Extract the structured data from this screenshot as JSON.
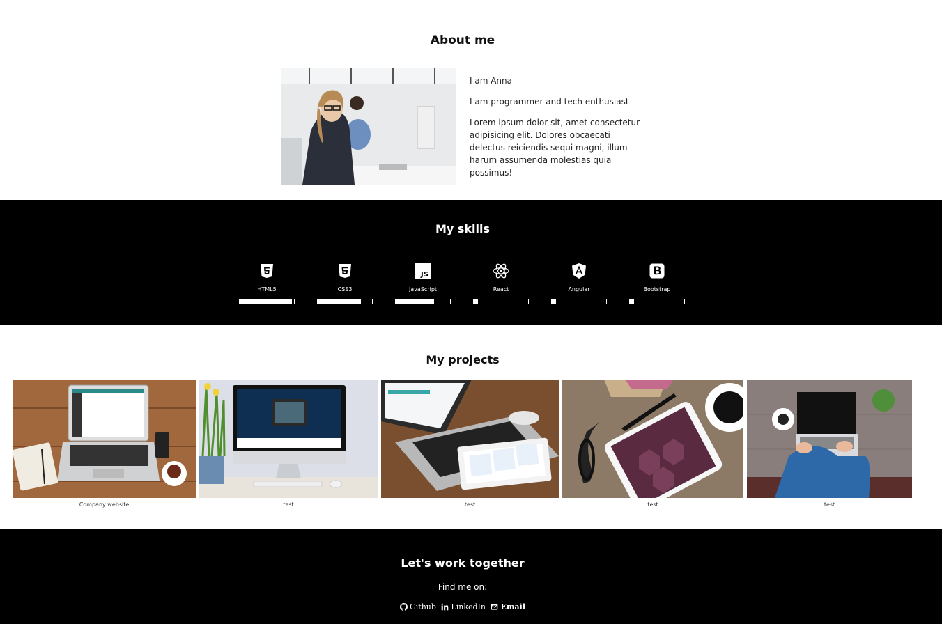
{
  "about": {
    "title": "About me",
    "line1": "I am Anna",
    "line2": "I am programmer and tech enthusiast",
    "line3": "Lorem ipsum dolor sit, amet consectetur adipisicing elit. Dolores obcaecati delectus reiciendis sequi magni, illum harum assumenda molestias quia possimus!"
  },
  "skills": {
    "title": "My skills",
    "items": [
      {
        "name": "HTML5",
        "level": 0.96,
        "icon": "html5-icon"
      },
      {
        "name": "CSS3",
        "level": 0.8,
        "icon": "css3-icon"
      },
      {
        "name": "JavaScript",
        "level": 0.7,
        "icon": "javascript-icon"
      },
      {
        "name": "React",
        "level": 0.08,
        "icon": "react-icon"
      },
      {
        "name": "Angular",
        "level": 0.08,
        "icon": "angular-icon"
      },
      {
        "name": "Bootstrap",
        "level": 0.08,
        "icon": "bootstrap-icon"
      }
    ]
  },
  "projects": {
    "title": "My projects",
    "items": [
      {
        "caption": "Company website"
      },
      {
        "caption": "test"
      },
      {
        "caption": "test"
      },
      {
        "caption": "test"
      },
      {
        "caption": "test"
      }
    ]
  },
  "footer": {
    "title": "Let's work together",
    "find": "Find me on:",
    "links": [
      "Github",
      "LinkedIn",
      "Email"
    ]
  }
}
